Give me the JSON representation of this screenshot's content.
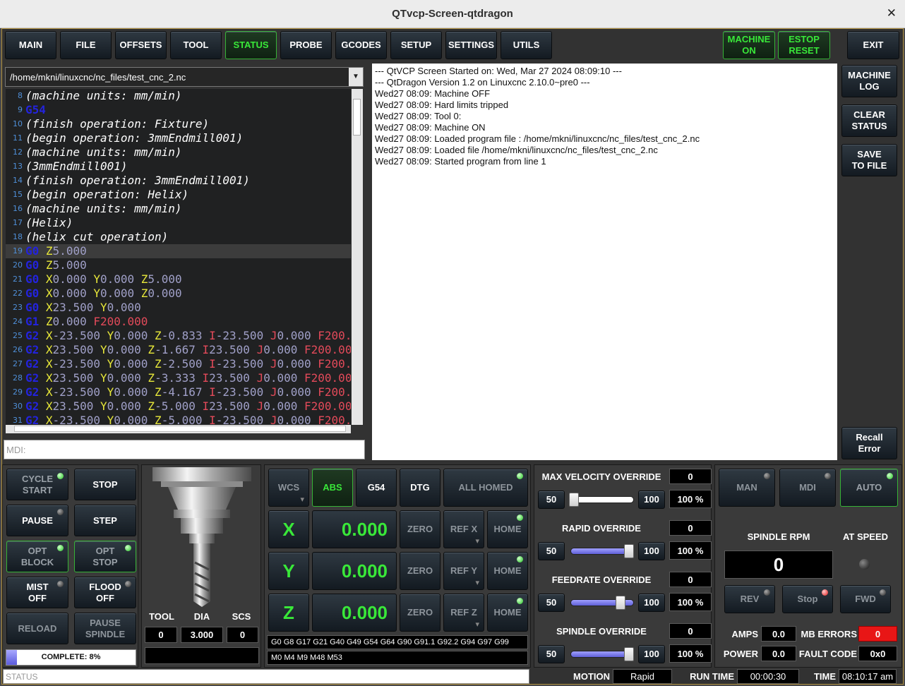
{
  "window": {
    "title": "QTvcp-Screen-qtdragon",
    "close": "✕"
  },
  "tabs": [
    "MAIN",
    "FILE",
    "OFFSETS",
    "TOOL",
    "STATUS",
    "PROBE",
    "GCODES",
    "SETUP",
    "SETTINGS",
    "UTILS"
  ],
  "top_right": {
    "machine_on": "MACHINE\nON",
    "estop_reset": "ESTOP\nRESET",
    "exit": "EXIT"
  },
  "file_path": "/home/mkni/linuxcnc/nc_files/test_cnc_2.nc",
  "code_lines": [
    {
      "n": "8",
      "t": [
        [
          "cm",
          "(machine units: mm/min)"
        ]
      ]
    },
    {
      "n": "9",
      "t": [
        [
          "gb",
          "G54"
        ]
      ]
    },
    {
      "n": "10",
      "t": [
        [
          "cm",
          "(finish operation: Fixture)"
        ]
      ]
    },
    {
      "n": "11",
      "t": [
        [
          "cm",
          "(begin operation: 3mmEndmill001)"
        ]
      ]
    },
    {
      "n": "12",
      "t": [
        [
          "cm",
          "(machine units: mm/min)"
        ]
      ]
    },
    {
      "n": "13",
      "t": [
        [
          "cm",
          "(3mmEndmill001)"
        ]
      ]
    },
    {
      "n": "14",
      "t": [
        [
          "cm",
          "(finish operation: 3mmEndmill001)"
        ]
      ]
    },
    {
      "n": "15",
      "t": [
        [
          "cm",
          "(begin operation: Helix)"
        ]
      ]
    },
    {
      "n": "16",
      "t": [
        [
          "cm",
          "(machine units: mm/min)"
        ]
      ]
    },
    {
      "n": "17",
      "t": [
        [
          "cm",
          "(Helix)"
        ]
      ]
    },
    {
      "n": "18",
      "t": [
        [
          "cm",
          "(helix cut operation)"
        ]
      ]
    },
    {
      "n": "19",
      "t": [
        [
          "gb",
          "G0"
        ],
        [
          "nm",
          " "
        ],
        [
          "ax",
          "Z"
        ],
        [
          "nm",
          "5.000"
        ]
      ],
      "hl": true
    },
    {
      "n": "20",
      "t": [
        [
          "gb",
          "G0"
        ],
        [
          "nm",
          " "
        ],
        [
          "ax",
          "Z"
        ],
        [
          "nm",
          "5.000"
        ]
      ]
    },
    {
      "n": "21",
      "t": [
        [
          "gb",
          "G0"
        ],
        [
          "nm",
          " "
        ],
        [
          "ax",
          "X"
        ],
        [
          "nm",
          "0.000 "
        ],
        [
          "ax",
          "Y"
        ],
        [
          "nm",
          "0.000 "
        ],
        [
          "ax",
          "Z"
        ],
        [
          "nm",
          "5.000"
        ]
      ]
    },
    {
      "n": "22",
      "t": [
        [
          "gb",
          "G0"
        ],
        [
          "nm",
          " "
        ],
        [
          "ax",
          "X"
        ],
        [
          "nm",
          "0.000 "
        ],
        [
          "ax",
          "Y"
        ],
        [
          "nm",
          "0.000 "
        ],
        [
          "ax",
          "Z"
        ],
        [
          "nm",
          "0.000"
        ]
      ]
    },
    {
      "n": "23",
      "t": [
        [
          "gb",
          "G0"
        ],
        [
          "nm",
          " "
        ],
        [
          "ax",
          "X"
        ],
        [
          "nm",
          "23.500 "
        ],
        [
          "ax",
          "Y"
        ],
        [
          "nm",
          "0.000"
        ]
      ]
    },
    {
      "n": "24",
      "t": [
        [
          "gb",
          "G1"
        ],
        [
          "nm",
          " "
        ],
        [
          "ax",
          "Z"
        ],
        [
          "nm",
          "0.000 "
        ],
        [
          "fr",
          "F200.000"
        ]
      ]
    },
    {
      "n": "25",
      "t": [
        [
          "gb",
          "G2"
        ],
        [
          "nm",
          " "
        ],
        [
          "ax",
          "X"
        ],
        [
          "nm",
          "-23.500 "
        ],
        [
          "ax",
          "Y"
        ],
        [
          "nm",
          "0.000 "
        ],
        [
          "ax",
          "Z"
        ],
        [
          "nm",
          "-0.833 "
        ],
        [
          "fr",
          "I"
        ],
        [
          "nm",
          "-23.500 "
        ],
        [
          "fr",
          "J"
        ],
        [
          "nm",
          "0.000 "
        ],
        [
          "fr",
          "F200."
        ]
      ]
    },
    {
      "n": "26",
      "t": [
        [
          "gb",
          "G2"
        ],
        [
          "nm",
          " "
        ],
        [
          "ax",
          "X"
        ],
        [
          "nm",
          "23.500 "
        ],
        [
          "ax",
          "Y"
        ],
        [
          "nm",
          "0.000 "
        ],
        [
          "ax",
          "Z"
        ],
        [
          "nm",
          "-1.667 "
        ],
        [
          "fr",
          "I"
        ],
        [
          "nm",
          "23.500 "
        ],
        [
          "fr",
          "J"
        ],
        [
          "nm",
          "0.000 "
        ],
        [
          "fr",
          "F200.00"
        ]
      ]
    },
    {
      "n": "27",
      "t": [
        [
          "gb",
          "G2"
        ],
        [
          "nm",
          " "
        ],
        [
          "ax",
          "X"
        ],
        [
          "nm",
          "-23.500 "
        ],
        [
          "ax",
          "Y"
        ],
        [
          "nm",
          "0.000 "
        ],
        [
          "ax",
          "Z"
        ],
        [
          "nm",
          "-2.500 "
        ],
        [
          "fr",
          "I"
        ],
        [
          "nm",
          "-23.500 "
        ],
        [
          "fr",
          "J"
        ],
        [
          "nm",
          "0.000 "
        ],
        [
          "fr",
          "F200."
        ]
      ]
    },
    {
      "n": "28",
      "t": [
        [
          "gb",
          "G2"
        ],
        [
          "nm",
          " "
        ],
        [
          "ax",
          "X"
        ],
        [
          "nm",
          "23.500 "
        ],
        [
          "ax",
          "Y"
        ],
        [
          "nm",
          "0.000 "
        ],
        [
          "ax",
          "Z"
        ],
        [
          "nm",
          "-3.333 "
        ],
        [
          "fr",
          "I"
        ],
        [
          "nm",
          "23.500 "
        ],
        [
          "fr",
          "J"
        ],
        [
          "nm",
          "0.000 "
        ],
        [
          "fr",
          "F200.00"
        ]
      ]
    },
    {
      "n": "29",
      "t": [
        [
          "gb",
          "G2"
        ],
        [
          "nm",
          " "
        ],
        [
          "ax",
          "X"
        ],
        [
          "nm",
          "-23.500 "
        ],
        [
          "ax",
          "Y"
        ],
        [
          "nm",
          "0.000 "
        ],
        [
          "ax",
          "Z"
        ],
        [
          "nm",
          "-4.167 "
        ],
        [
          "fr",
          "I"
        ],
        [
          "nm",
          "-23.500 "
        ],
        [
          "fr",
          "J"
        ],
        [
          "nm",
          "0.000 "
        ],
        [
          "fr",
          "F200."
        ]
      ]
    },
    {
      "n": "30",
      "t": [
        [
          "gb",
          "G2"
        ],
        [
          "nm",
          " "
        ],
        [
          "ax",
          "X"
        ],
        [
          "nm",
          "23.500 "
        ],
        [
          "ax",
          "Y"
        ],
        [
          "nm",
          "0.000 "
        ],
        [
          "ax",
          "Z"
        ],
        [
          "nm",
          "-5.000 "
        ],
        [
          "fr",
          "I"
        ],
        [
          "nm",
          "23.500 "
        ],
        [
          "fr",
          "J"
        ],
        [
          "nm",
          "0.000 "
        ],
        [
          "fr",
          "F200.00"
        ]
      ]
    },
    {
      "n": "31",
      "t": [
        [
          "gb",
          "G2"
        ],
        [
          "nm",
          " "
        ],
        [
          "ax",
          "X"
        ],
        [
          "nm",
          "-23.500 "
        ],
        [
          "ax",
          "Y"
        ],
        [
          "nm",
          "0.000 "
        ],
        [
          "ax",
          "Z"
        ],
        [
          "nm",
          "-5.000 "
        ],
        [
          "fr",
          "I"
        ],
        [
          "nm",
          "-23.500 "
        ],
        [
          "fr",
          "J"
        ],
        [
          "nm",
          "0.000 "
        ],
        [
          "fr",
          "F200."
        ]
      ]
    }
  ],
  "mdi_placeholder": "MDI:",
  "log_lines": [
    "--- QtVCP Screen Started on: Wed, Mar 27 2024 08:09:10 ---",
    "--- QtDragon Version 1.2 on Linuxcnc 2.10.0~pre0 ---",
    "Wed27 08:09: Machine OFF",
    "Wed27 08:09: Hard limits tripped",
    "Wed27 08:09: Tool 0:",
    "Wed27 08:09: Machine ON",
    "Wed27 08:09: Loaded program file : /home/mkni/linuxcnc/nc_files/test_cnc_2.nc",
    "Wed27 08:09: Loaded file /home/mkni/linuxcnc/nc_files/test_cnc_2.nc",
    "Wed27 08:09: Started program from line 1"
  ],
  "log_buttons": {
    "machine_log": "MACHINE\nLOG",
    "clear_status": "CLEAR\nSTATUS",
    "save_to_file": "SAVE\nTO FILE",
    "recall_error": "Recall\nError"
  },
  "run": {
    "cycle_start": "CYCLE\nSTART",
    "stop": "STOP",
    "pause": "PAUSE",
    "step": "STEP",
    "opt_block": "OPT\nBLOCK",
    "opt_stop": "OPT\nSTOP",
    "mist": "MIST\nOFF",
    "flood": "FLOOD\nOFF",
    "reload": "RELOAD",
    "pause_spindle": "PAUSE\nSPINDLE",
    "complete": "COMPLETE: 8%",
    "progress": 0.08
  },
  "tool": {
    "h_tool": "TOOL",
    "h_dia": "DIA",
    "h_scs": "SCS",
    "tool": "0",
    "dia": "3.000",
    "scs": "0"
  },
  "dro": {
    "wcs": "WCS",
    "abs": "ABS",
    "g54": "G54",
    "dtg": "DTG",
    "all_homed": "ALL HOMED",
    "zero": "ZERO",
    "home": "HOME",
    "axes": [
      {
        "l": "X",
        "v": "0.000",
        "ref": "REF X"
      },
      {
        "l": "Y",
        "v": "0.000",
        "ref": "REF Y"
      },
      {
        "l": "Z",
        "v": "0.000",
        "ref": "REF Z"
      }
    ],
    "gcodes": "G0 G8 G17 G21 G40 G49 G54 G64 G90 G91.1 G92.2 G94 G97 G99",
    "mcodes": "M0 M4 M9 M48 M53"
  },
  "overrides": [
    {
      "title": "MAX VELOCITY OVERRIDE",
      "val": "0",
      "lo": "50",
      "hi": "100",
      "pct": "100 %",
      "fill": 0
    },
    {
      "title": "RAPID OVERRIDE",
      "val": "0",
      "lo": "50",
      "hi": "100",
      "pct": "100 %",
      "fill": 1
    },
    {
      "title": "FEEDRATE OVERRIDE",
      "val": "0",
      "lo": "50",
      "hi": "100",
      "pct": "100 %",
      "fill": 0.85
    },
    {
      "title": "SPINDLE OVERRIDE",
      "val": "0",
      "lo": "50",
      "hi": "100",
      "pct": "100 %",
      "fill": 1
    }
  ],
  "mode": {
    "man": "MAN",
    "mdi": "MDI",
    "auto": "AUTO"
  },
  "spindle": {
    "rpm_label": "SPINDLE RPM",
    "at_speed": "AT SPEED",
    "rpm": "0",
    "rev": "REV",
    "stop": "Stop",
    "fwd": "FWD",
    "amps_l": "AMPS",
    "amps": "0.0",
    "mb_l": "MB ERRORS",
    "mb": "0",
    "power_l": "POWER",
    "power": "0.0",
    "fault_l": "FAULT CODE",
    "fault": "0x0"
  },
  "status": {
    "placeholder": "STATUS",
    "motion_l": "MOTION",
    "motion": "Rapid",
    "runtime_l": "RUN TIME",
    "runtime": "00:00:30",
    "time_l": "TIME",
    "time": "08:10:17 am"
  }
}
